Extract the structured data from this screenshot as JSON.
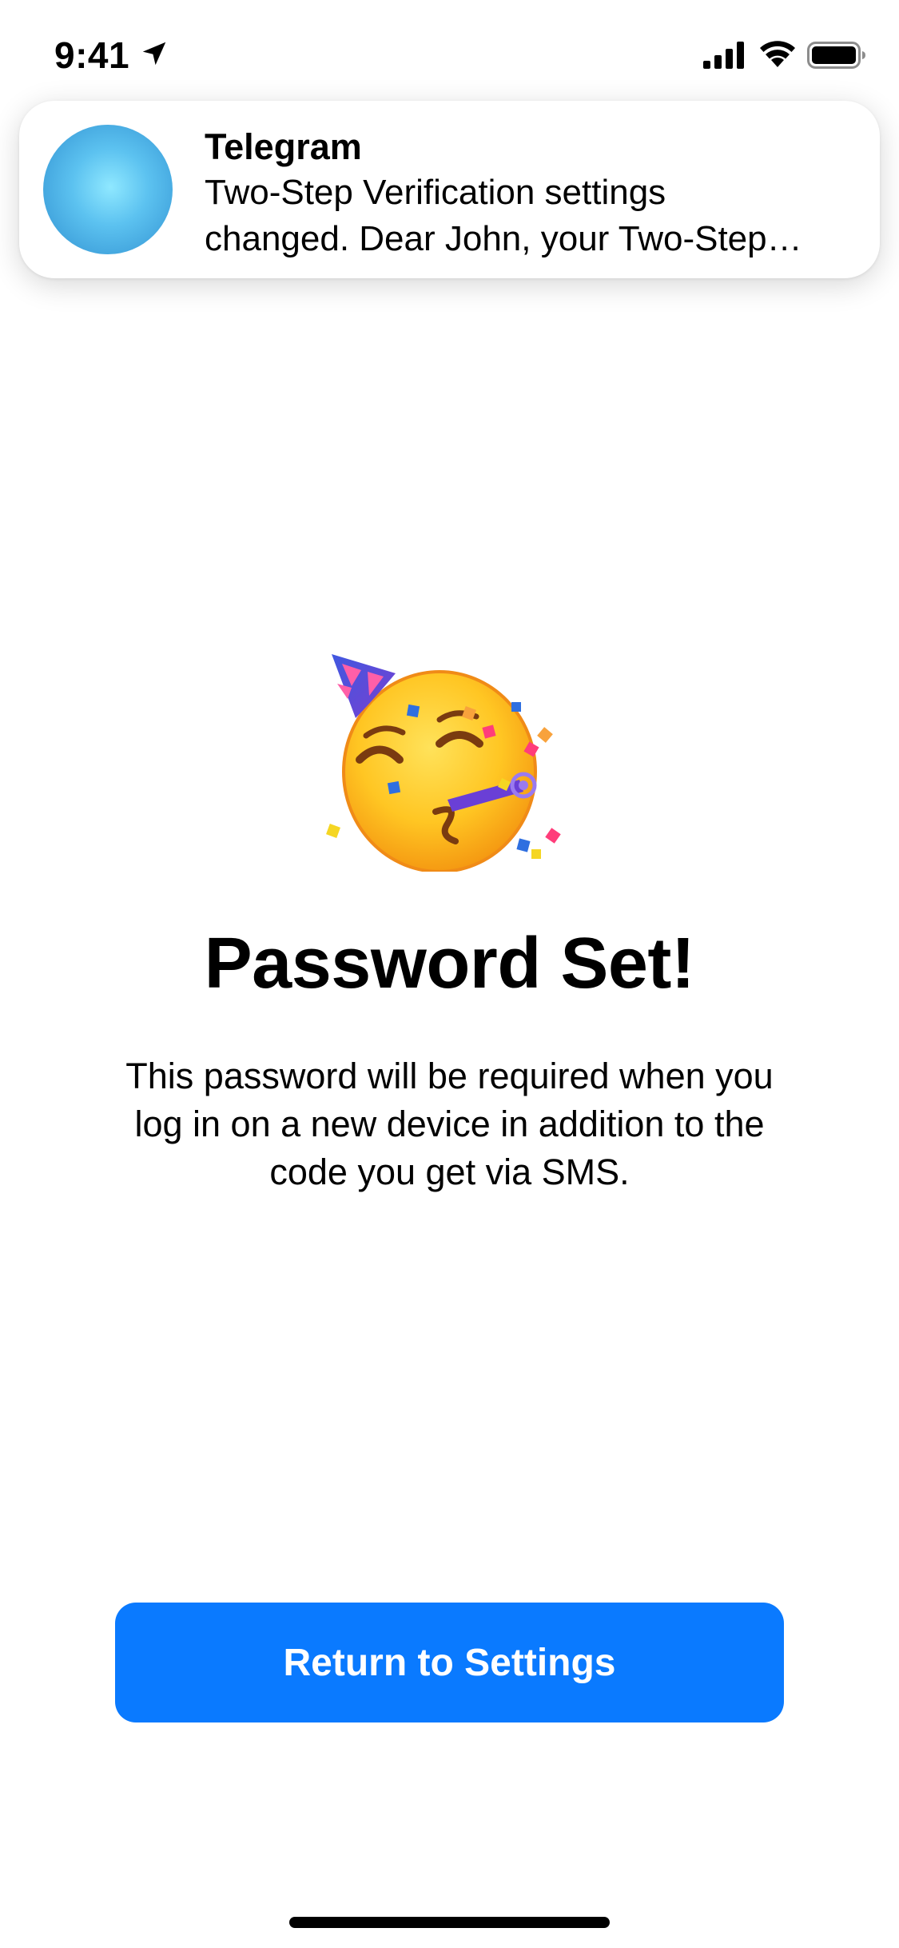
{
  "status_bar": {
    "time": "9:41",
    "icons": [
      "location-arrow-icon",
      "cellular-signal-icon",
      "wifi-icon",
      "battery-icon"
    ]
  },
  "notification": {
    "app_name": "Telegram",
    "line1": "Two-Step Verification settings",
    "line2": "changed. Dear John, your Two-Step…",
    "avatar_icon": "telegram-avatar"
  },
  "main": {
    "emoji_icon": "partying-face-emoji",
    "title": "Password Set!",
    "description_lines": [
      "This password will be required when you",
      "log in on a new device in addition to the",
      "code you get via SMS."
    ],
    "button_label": "Return to Settings"
  },
  "colors": {
    "accent": "#0a7aff",
    "background": "#ffffff",
    "text": "#000000"
  }
}
